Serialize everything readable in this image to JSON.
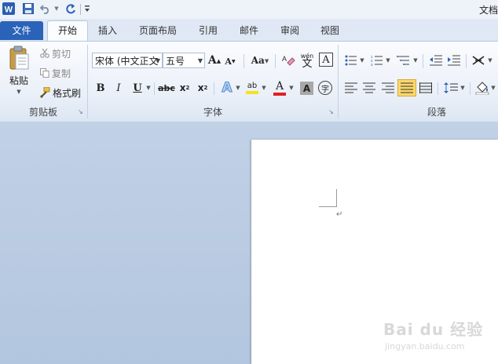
{
  "app": {
    "title": "文档"
  },
  "tabs": [
    {
      "label": "文件"
    },
    {
      "label": "开始"
    },
    {
      "label": "插入"
    },
    {
      "label": "页面布局"
    },
    {
      "label": "引用"
    },
    {
      "label": "邮件"
    },
    {
      "label": "审阅"
    },
    {
      "label": "视图"
    }
  ],
  "clipboard": {
    "paste_label": "粘贴",
    "cut_label": "剪切",
    "copy_label": "复制",
    "format_painter_label": "格式刷",
    "group_label": "剪贴板"
  },
  "font": {
    "font_name": "宋体 (中文正文",
    "font_size": "五号",
    "grow_glyph": "A",
    "shrink_glyph": "A",
    "case_glyph": "Aa",
    "phonetic_glyph": "wén",
    "phonetic_char": "文",
    "border_glyph": "A",
    "bold": "B",
    "italic": "I",
    "underline": "U",
    "strike": "abc",
    "subscript": "x",
    "superscript": "x",
    "effects_glyph": "A",
    "highlight_glyph": "ab",
    "color_glyph": "A",
    "shading_glyph": "A",
    "enclose_glyph": "字",
    "group_label": "字体"
  },
  "paragraph": {
    "group_label": "段落"
  },
  "document": {
    "paragraph_mark": "↵"
  },
  "watermark": {
    "brand": "Bai du 经验",
    "url": "jingyan.baidu.com"
  },
  "colors": {
    "file_tab": "#2a63b8",
    "accent_red": "#e02020",
    "highlight_yellow": "#f5e21e",
    "active_align": "#fbd86b"
  }
}
